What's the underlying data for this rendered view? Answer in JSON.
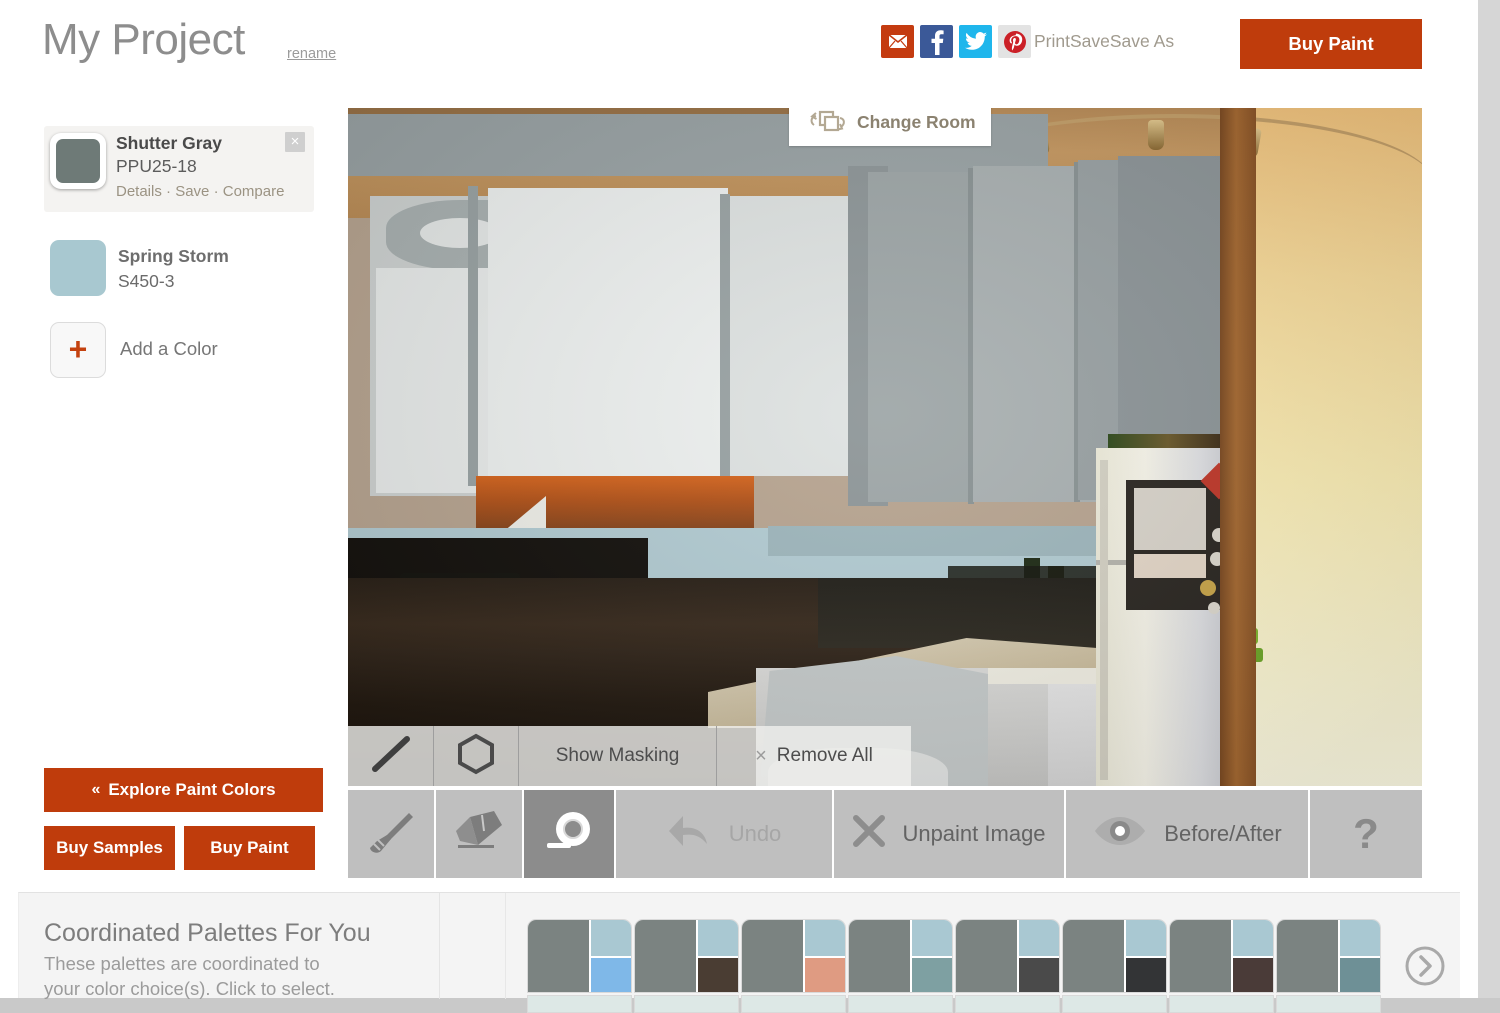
{
  "header": {
    "project_title": "My Project",
    "rename_label": "rename",
    "share_icons": [
      {
        "name": "email-share-icon",
        "glyph": "envelope",
        "color": "#c43b10"
      },
      {
        "name": "facebook-share-icon",
        "glyph": "f",
        "color": "#3b5998"
      },
      {
        "name": "twitter-share-icon",
        "glyph": "bird",
        "color": "#1fb6ec"
      },
      {
        "name": "pinterest-share-icon",
        "glyph": "P",
        "color": "#e3e3e3"
      }
    ],
    "print_label": "Print",
    "save_label": "Save",
    "save_as_label": "Save As",
    "separator": "·",
    "buy_paint_label": "Buy Paint",
    "accent_color": "#bf3c0c"
  },
  "sidebar": {
    "colors": [
      {
        "name": "Shutter Gray",
        "code": "PPU25-18",
        "hex": "#6e7a77",
        "selected": true,
        "links": "Details · Save · Compare",
        "details_label": "Details",
        "save_label": "Save",
        "compare_label": "Compare",
        "close_label": "×"
      },
      {
        "name": "Spring Storm",
        "code": "S450-3",
        "hex": "#a8c8d0",
        "selected": false
      }
    ],
    "add_color_label": "Add a Color",
    "add_color_plus": "+",
    "explore_label": "Explore Paint Colors",
    "explore_chevron": "«",
    "buy_samples_label": "Buy Samples",
    "buy_paint_label": "Buy Paint"
  },
  "stage": {
    "change_room_label": "Change Room",
    "change_room_icon": "change-room-icon",
    "scene": "painted kitchen photo"
  },
  "mask_bar": {
    "line_tool_icon": "line-tool-icon",
    "polygon_tool_icon": "polygon-tool-icon",
    "show_masking_label": "Show Masking",
    "remove_all_label": "Remove All",
    "remove_all_x": "×"
  },
  "toolbar": {
    "tools": [
      {
        "name": "paint-brush-tool",
        "label": "",
        "icon": "brush-icon",
        "active": false,
        "disabled": false
      },
      {
        "name": "eraser-tool",
        "label": "",
        "icon": "eraser-icon",
        "active": false,
        "disabled": false
      },
      {
        "name": "masking-tape-tool",
        "label": "",
        "icon": "tape-roll-icon",
        "active": true,
        "disabled": false
      },
      {
        "name": "undo-button",
        "label": "Undo",
        "icon": "undo-arrow-icon",
        "active": false,
        "disabled": true
      },
      {
        "name": "unpaint-image-button",
        "label": "Unpaint Image",
        "icon": "x-icon",
        "active": false,
        "disabled": false
      },
      {
        "name": "before-after-button",
        "label": "Before/After",
        "icon": "eye-icon",
        "active": false,
        "disabled": false
      },
      {
        "name": "help-button",
        "label": "?",
        "icon": "question-mark-icon",
        "active": false,
        "disabled": false
      }
    ]
  },
  "palettes": {
    "title": "Coordinated Palettes For You",
    "subtitle_line1": "These palettes are coordinated to",
    "subtitle_line2": "your color choice(s). Click to select.",
    "next_arrow_icon": "chevron-right-circle-icon",
    "cards": [
      {
        "main": "#7b8381",
        "top_right": "#a9c8d2",
        "bottom_right": "#7fb8e8",
        "strip": "#dde8e6"
      },
      {
        "main": "#7b8381",
        "top_right": "#a9c8d2",
        "bottom_right": "#4a3d33",
        "strip": "#dde8e6"
      },
      {
        "main": "#7b8381",
        "top_right": "#a9c8d2",
        "bottom_right": "#df9b82",
        "strip": "#dde8e6"
      },
      {
        "main": "#7b8381",
        "top_right": "#a9c8d2",
        "bottom_right": "#7ea0a2",
        "strip": "#dde8e6"
      },
      {
        "main": "#7b8381",
        "top_right": "#a9c8d2",
        "bottom_right": "#4a4a4a",
        "strip": "#dde8e6"
      },
      {
        "main": "#7b8381",
        "top_right": "#a9c8d2",
        "bottom_right": "#333436",
        "strip": "#dde8e6"
      },
      {
        "main": "#7b8381",
        "top_right": "#a9c8d2",
        "bottom_right": "#4a3b38",
        "strip": "#dde8e6"
      },
      {
        "main": "#7b8381",
        "top_right": "#a9c8d2",
        "bottom_right": "#6e9096",
        "strip": "#dde8e6"
      }
    ]
  }
}
